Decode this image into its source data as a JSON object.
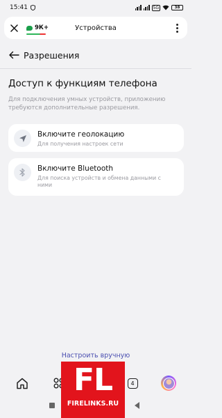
{
  "status_bar": {
    "time": "15:41",
    "battery": "38"
  },
  "top_bar": {
    "badge": "9К+",
    "title": "Устройства"
  },
  "header": {
    "title": "Разрешения"
  },
  "section": {
    "title": "Доступ к функциям телефона",
    "description": "Для подключения умных устройств, приложению требуются дополнительные разрешения."
  },
  "cards": [
    {
      "title": "Включите геолокацию",
      "subtitle": "Для получения настроек сети",
      "icon": "location-arrow-icon"
    },
    {
      "title": "Включите Bluetooth",
      "subtitle": "Для поиска устройств и обмена данными с ними",
      "icon": "bluetooth-icon"
    }
  ],
  "manual_link": "Настроить вручную",
  "nav": {
    "tab_count": "4"
  },
  "watermark": {
    "big": "FL",
    "small": "FIRELINKS.RU"
  },
  "colors": {
    "accent_link": "#4a4eb0",
    "alice_green": "#1b9f4b",
    "watermark_red": "#e2141c"
  }
}
